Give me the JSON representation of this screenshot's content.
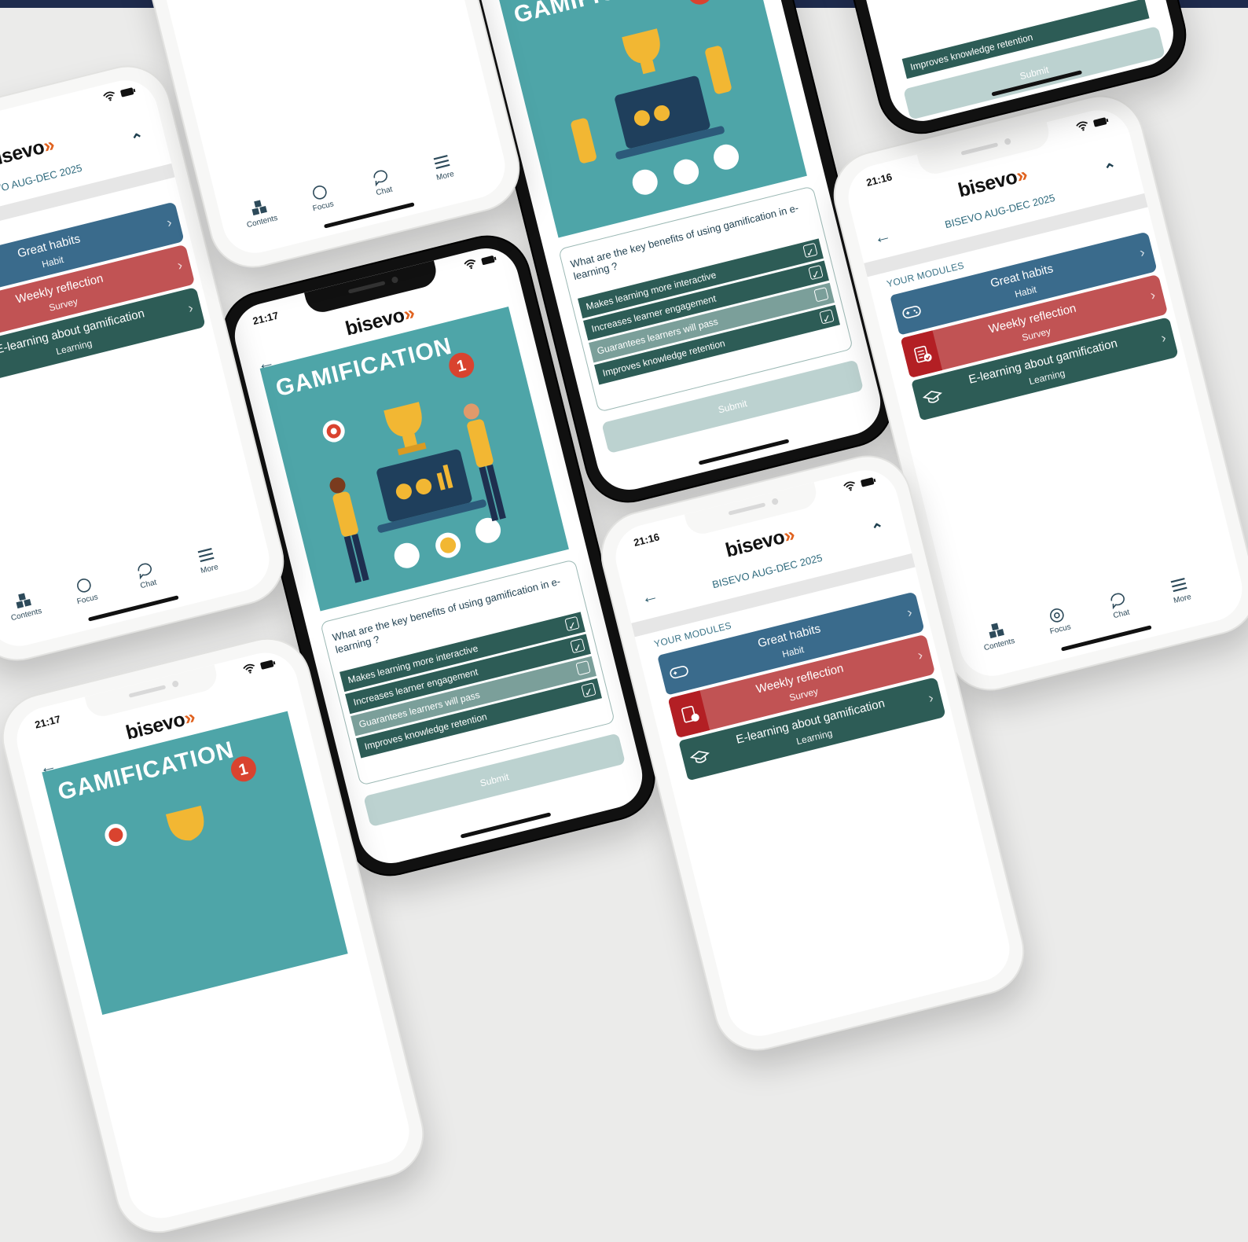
{
  "brand": {
    "name": "bisevo",
    "chevrons": "»"
  },
  "modules_screen": {
    "time": "21:16",
    "program": "BISEVO AUG-DEC 2025",
    "section": "YOUR MODULES",
    "modules": [
      {
        "title": "Great habits",
        "type": "Habit",
        "icon": "gamepad-icon"
      },
      {
        "title": "Weekly reflection",
        "type": "Survey",
        "icon": "clipboard-check-icon"
      },
      {
        "title": "E-learning about gamification",
        "type": "Learning",
        "icon": "graduation-cap-icon"
      }
    ],
    "tabs": [
      "Contents",
      "Focus",
      "Chat",
      "More"
    ]
  },
  "quiz_screen": {
    "time": "21:17",
    "poster_title": "GAMIFICATION",
    "question": "What are the key benefits of using gamification in e-learning ?",
    "answers": [
      {
        "text": "Makes learning more interactive",
        "checked": true
      },
      {
        "text": "Increases learner engagement",
        "checked": true
      },
      {
        "text": "Guarantees learners will pass",
        "checked": false
      },
      {
        "text": "Improves knowledge retention",
        "checked": true
      }
    ],
    "submit_label": "Submit"
  },
  "colors": {
    "habit": "#3a6b8c",
    "survey": "#c15354",
    "learning": "#2d5c56",
    "accent": "#e0621f",
    "teal_poster": "#4ea5a8"
  }
}
